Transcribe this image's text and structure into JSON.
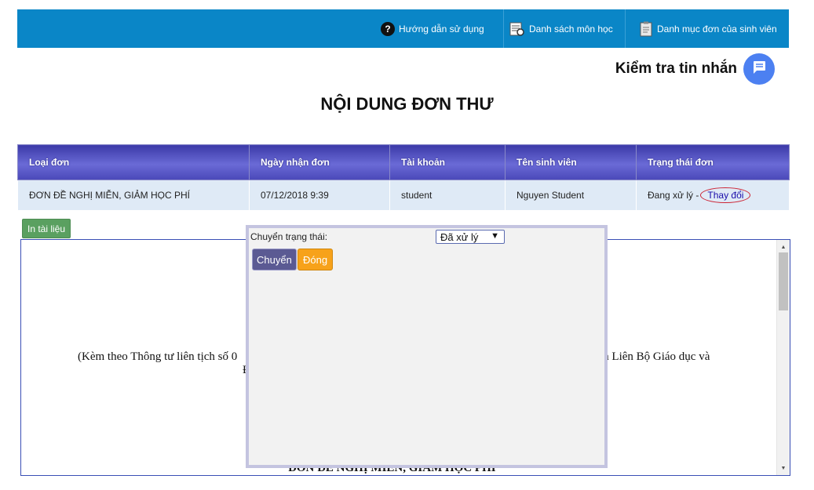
{
  "nav": {
    "guide_label": "Hướng dẫn sử dụng",
    "courses_label": "Danh sách môn học",
    "requests_label": "Danh mục đơn của sinh viên"
  },
  "messages": {
    "label": "Kiểm tra tin nhắn"
  },
  "page_title": "NỘI DUNG ĐƠN THƯ",
  "table": {
    "headers": [
      "Loại đơn",
      "Ngày nhận đơn",
      "Tài khoản",
      "Tên sinh viên",
      "Trạng thái đơn"
    ],
    "row": {
      "type": "ĐƠN ĐỀ NGHỊ MIỄN, GIẢM HỌC PHÍ",
      "date": "07/12/2018 9:39",
      "account": "student",
      "student_name": "Nguyen Student",
      "status": "Đang xử lý -",
      "change_link": "Thay đổi"
    }
  },
  "print_button": "In tài liệu",
  "document": {
    "line1_left": "(Kèm theo Thông tư liên tịch số 0",
    "line1_right": "a Liên Bộ Giáo dục và",
    "line2": "Đ",
    "heading": "ĐƠN ĐỀ NGHỊ MIỄN, GIẢM HỌC PHÍ"
  },
  "popup": {
    "label": "Chuyển trạng thái:",
    "selected": "Đã xử lý",
    "move_button": "Chuyển",
    "close_button": "Đóng"
  }
}
